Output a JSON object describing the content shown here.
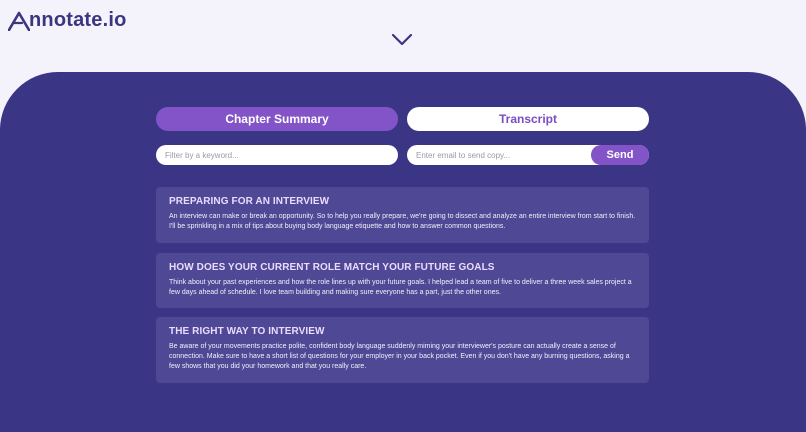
{
  "app": {
    "logo_text": "nnotate.io",
    "logo_initial": "A"
  },
  "colors": {
    "background": "#f4f3fb",
    "panel": "#3b3585",
    "accent": "#8254c7",
    "card": "#4f4895",
    "card_title": "#e9dcff"
  },
  "tabs": [
    {
      "label": "Chapter Summary",
      "active": true
    },
    {
      "label": "Transcript",
      "active": false
    }
  ],
  "filter": {
    "placeholder": "Filter by a keyword..."
  },
  "email": {
    "placeholder": "Enter email to send copy...",
    "send_label": "Send"
  },
  "chapters": [
    {
      "title": "PREPARING FOR AN INTERVIEW",
      "body": "An interview can make or break an opportunity. So to help you really prepare, we're going to dissect and analyze an entire interview from start to finish. I'll be sprinkling in a mix of tips about buying body language etiquette and how to answer common questions."
    },
    {
      "title": "HOW DOES YOUR CURRENT ROLE MATCH YOUR FUTURE GOALS",
      "body": "Think about your past experiences and how the role lines up with your future goals. I helped lead a team of five to deliver a three week sales project a few days ahead of schedule. I love team building and making sure everyone has a part, just the other ones."
    },
    {
      "title": "THE RIGHT WAY TO INTERVIEW",
      "body": "Be aware of your movements practice polite, confident body language suddenly miming your interviewer's posture can actually create a sense of connection. Make sure to have a short list of questions for your employer in your back pocket. Even if you don't have any burning questions, asking a few shows that you did your homework and that you really care."
    }
  ]
}
